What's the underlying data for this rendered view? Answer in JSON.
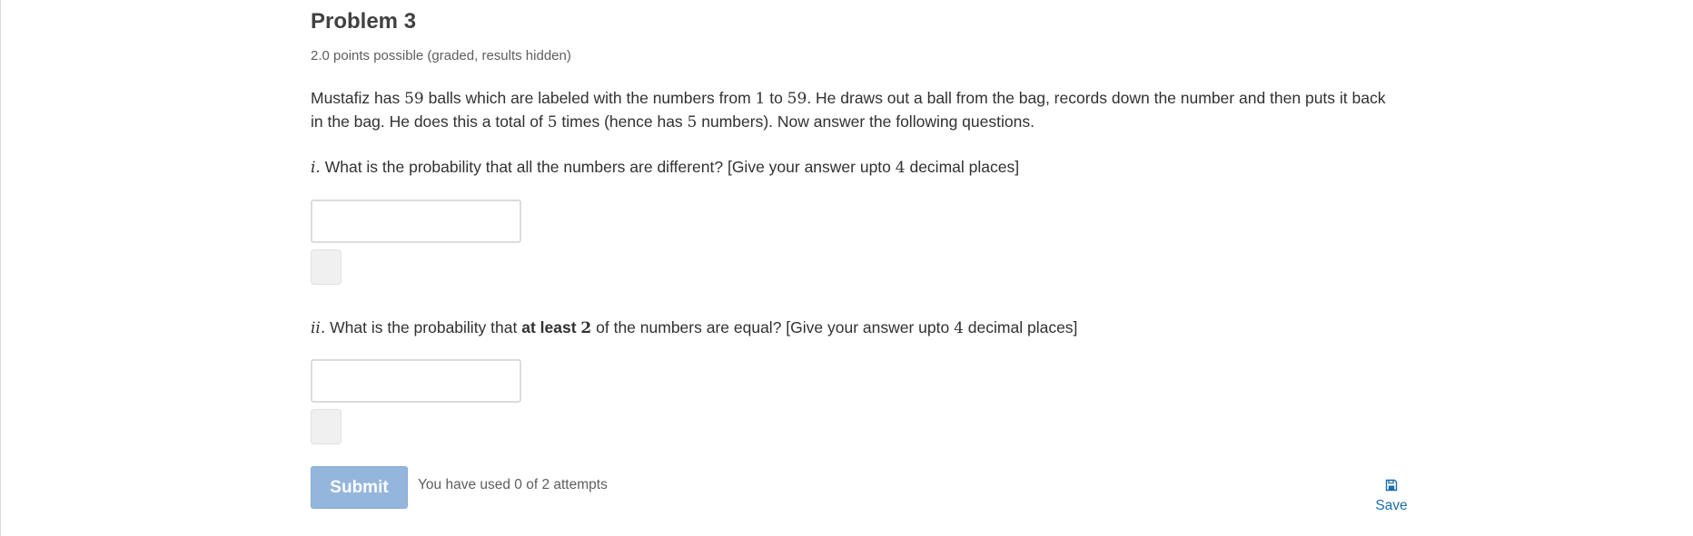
{
  "problem": {
    "title": "Problem 3",
    "points": "2.0 points possible (graded, results hidden)",
    "intro": {
      "t1": "Mustafiz has ",
      "n_balls": "59",
      "t2": " balls which are labeled with the numbers from ",
      "n_low": "1",
      "t3": " to ",
      "n_high": "59",
      "t4": ". He draws out a ball from the bag, records down the number and then puts it back in the bag. He does this a total of ",
      "n_times": "5",
      "t5": " times (hence has ",
      "n_numbers": "5",
      "t6": " numbers). Now answer the following questions."
    },
    "q1": {
      "label": "i.",
      "t1": " What is the probability that all the numbers are different? [Give your answer upto ",
      "n_places": "4",
      "t2": " decimal places]",
      "answer_value": ""
    },
    "q2": {
      "label": "ii.",
      "t1": " What is the probability that ",
      "bold": "at least ",
      "n_equal": "2",
      "t2": " of the numbers are equal? [Give your answer upto ",
      "n_places": "4",
      "t3": " decimal places]",
      "answer_value": ""
    },
    "submit_label": "Submit",
    "attempts_text": "You have used 0 of 2 attempts",
    "save_label": "Save",
    "save_icon": "floppy-disk-icon"
  },
  "colors": {
    "submit_bg": "#94b5dc",
    "link": "#1a6eae",
    "text": "#313131",
    "muted": "#5e5e5e"
  }
}
